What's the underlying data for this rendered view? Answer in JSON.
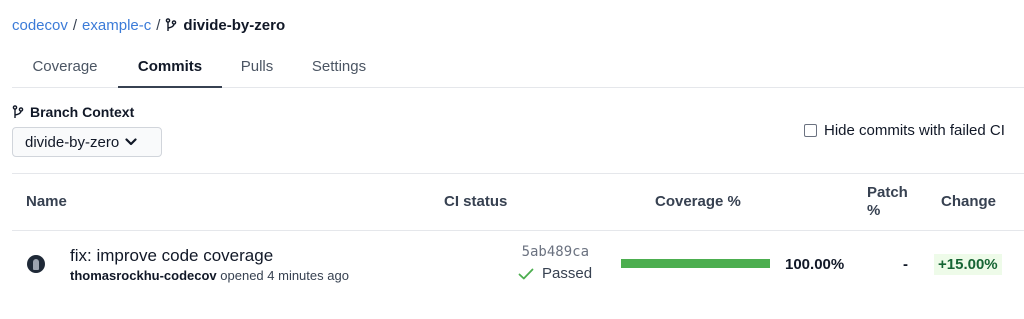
{
  "breadcrumb": {
    "org": "codecov",
    "repo": "example-c",
    "branch": "divide-by-zero",
    "separator": "/"
  },
  "tabs": [
    {
      "label": "Coverage",
      "active": false
    },
    {
      "label": "Commits",
      "active": true
    },
    {
      "label": "Pulls",
      "active": false
    },
    {
      "label": "Settings",
      "active": false
    }
  ],
  "branch_context": {
    "label": "Branch Context",
    "selected": "divide-by-zero"
  },
  "filter": {
    "hide_failed_label": "Hide commits with failed CI",
    "checked": false
  },
  "table": {
    "headers": {
      "name": "Name",
      "ci_status": "CI status",
      "coverage": "Coverage %",
      "patch_line1": "Patch",
      "patch_line2": "%",
      "change": "Change"
    },
    "rows": [
      {
        "title": "fix: improve code coverage",
        "author": "thomasrockhu-codecov",
        "opened": "opened 4 minutes ago",
        "sha": "5ab489ca",
        "ci_status": "Passed",
        "coverage_value": 100,
        "coverage_label": "100.00%",
        "patch": "-",
        "change": "+15.00%"
      }
    ]
  },
  "colors": {
    "link": "#3b7bd8",
    "coverage_bar": "#4cae4f",
    "passed": "#4cae4f",
    "change_positive": "#166534"
  },
  "icons": {
    "branch": "git-branch-icon",
    "dropdown": "chevron-down-icon",
    "ci_passed": "checkmark-icon"
  }
}
